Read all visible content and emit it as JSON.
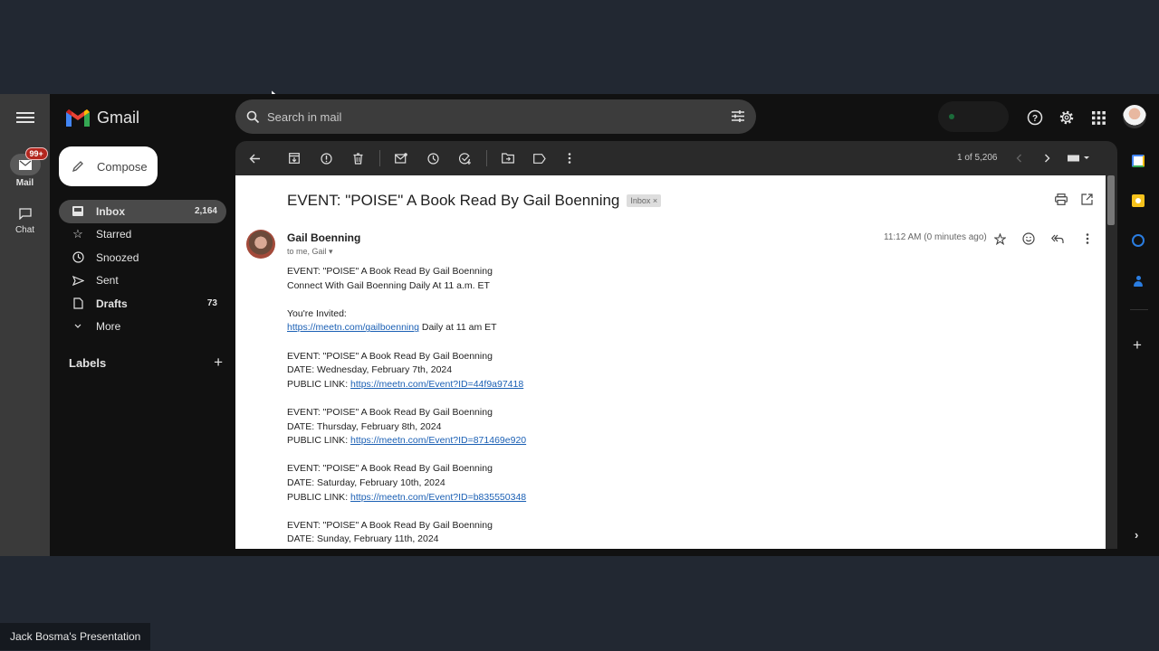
{
  "app": {
    "name": "Gmail",
    "menu_icon": "hamburger-menu-icon"
  },
  "rail": {
    "items": [
      {
        "label": "Mail",
        "icon": "mail-icon",
        "badge": "99+",
        "active": true
      },
      {
        "label": "Chat",
        "icon": "chat-icon",
        "active": false
      }
    ]
  },
  "compose": {
    "label": "Compose",
    "icon": "pencil-icon"
  },
  "nav": {
    "items": [
      {
        "label": "Inbox",
        "icon": "inbox-icon",
        "count": "2,164",
        "active": true
      },
      {
        "label": "Starred",
        "icon": "star-icon",
        "count": ""
      },
      {
        "label": "Snoozed",
        "icon": "clock-icon",
        "count": ""
      },
      {
        "label": "Sent",
        "icon": "send-icon",
        "count": ""
      },
      {
        "label": "Drafts",
        "icon": "draft-icon",
        "count": "73",
        "bold": true
      },
      {
        "label": "More",
        "icon": "chevron-down-icon",
        "count": ""
      }
    ],
    "labels_heading": "Labels"
  },
  "search": {
    "placeholder": "Search in mail"
  },
  "toolbar": {
    "pager": "1 of 5,206",
    "actions": [
      "Back",
      "Archive",
      "Report spam",
      "Delete",
      "Mark as unread",
      "Snooze",
      "Add to Tasks",
      "Move to",
      "Labels",
      "More"
    ]
  },
  "email": {
    "subject": "EVENT: \"POISE\" A Book Read By Gail Boenning",
    "label_tag": "Inbox ×",
    "sender": "Gail Boenning",
    "to": "to me, Gail",
    "time": "11:12 AM (0 minutes ago)",
    "body": {
      "intro_line1": "EVENT: \"POISE\" A Book Read By Gail Boenning",
      "intro_line2": "Connect With Gail Boenning Daily At 11 a.m. ET",
      "invite_label": "You're Invited:",
      "invite_link": "https://meetn.com/gailboenning",
      "invite_suffix": " Daily at 11 am ET",
      "events": [
        {
          "event": "EVENT: \"POISE\" A Book Read By Gail Boenning",
          "date": "DATE: Wednesday, February 7th, 2024",
          "link_label": "PUBLIC LINK: ",
          "link": "https://meetn.com/Event?ID=44f9a97418"
        },
        {
          "event": "EVENT: \"POISE\" A Book Read By Gail Boenning",
          "date": "DATE: Thursday, February 8th, 2024",
          "link_label": "PUBLIC LINK: ",
          "link": "https://meetn.com/Event?ID=871469e920"
        },
        {
          "event": "EVENT: \"POISE\" A Book Read By Gail Boenning",
          "date": "DATE: Saturday, February 10th, 2024",
          "link_label": "PUBLIC LINK: ",
          "link": "https://meetn.com/Event?ID=b835550348"
        },
        {
          "event": "EVENT: \"POISE\" A Book Read By Gail Boenning",
          "date": "DATE: Sunday, February 11th, 2024"
        }
      ]
    }
  },
  "side_apps": [
    "calendar-icon",
    "keep-icon",
    "tasks-icon",
    "contacts-icon",
    "add-icon",
    "expand-icon"
  ],
  "caption": "Jack Bosma's Presentation"
}
